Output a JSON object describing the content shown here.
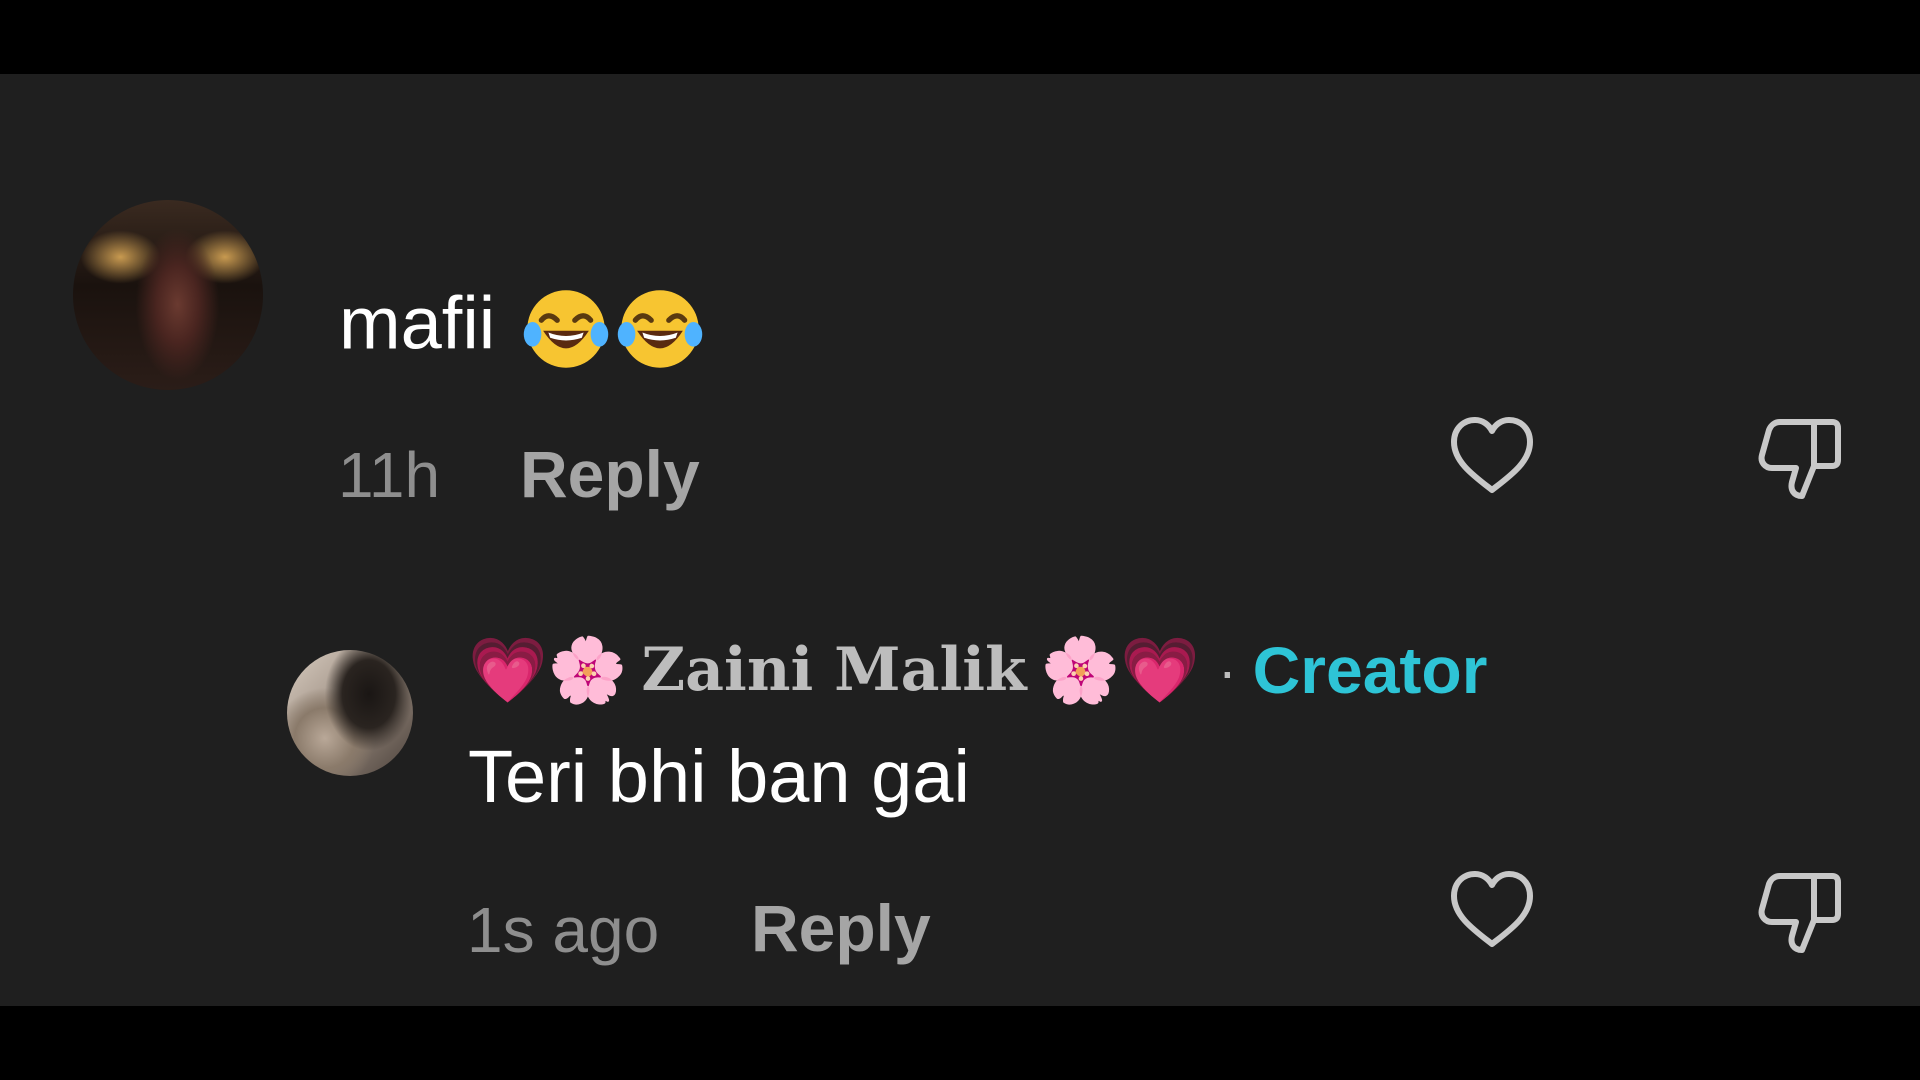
{
  "comments": [
    {
      "text": "mafii",
      "emojis": [
        "face-with-tears-of-joy",
        "face-with-tears-of-joy"
      ],
      "time": "11h",
      "reply_label": "Reply"
    }
  ],
  "reply": {
    "author": "Zaini Malik",
    "author_prefix_emojis": [
      "💗",
      "🌸"
    ],
    "author_suffix_emojis": [
      "🌸",
      "💗"
    ],
    "separator": "·",
    "badge": "Creator",
    "text": "Teri bhi ban gai",
    "time": "1s ago",
    "reply_label": "Reply"
  },
  "icons": {
    "like": "heart-outline-icon",
    "dislike": "thumbs-down-outline-icon"
  },
  "colors": {
    "background": "#1f1f1f",
    "letterbox": "#000000",
    "creator_badge": "#2ec4d6",
    "text_primary": "#ffffff",
    "text_meta": "#8e8e8e"
  }
}
